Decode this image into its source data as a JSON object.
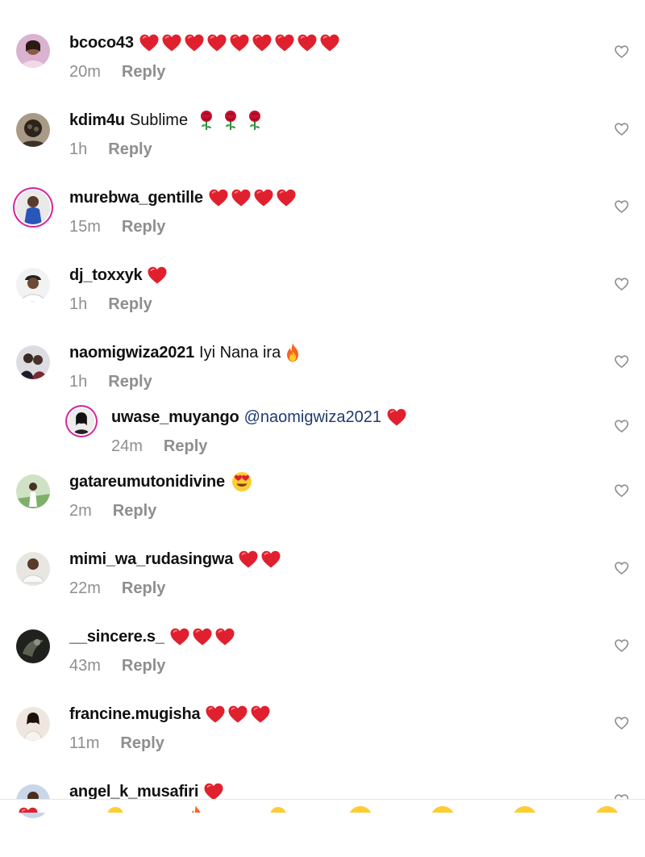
{
  "reply_label": "Reply",
  "colors": {
    "username": "#111111",
    "meta": "#8e8e8e",
    "mention": "#1f3a6e",
    "heart": "#e0202e",
    "story_ring": "#d6249f"
  },
  "icons": {
    "like": "heart-outline-icon",
    "heart_emoji": "red-heart-icon",
    "rose_emoji": "rose-icon",
    "fire_emoji": "fire-icon",
    "heart_eyes_emoji": "heart-eyes-icon"
  },
  "comments": [
    {
      "username": "bcoco43",
      "text": "",
      "hearts": 9,
      "time": "20m"
    },
    {
      "username": "kdim4u",
      "text": "Sublime",
      "roses": 3,
      "time": "1h"
    },
    {
      "username": "murebwa_gentille",
      "text": "",
      "hearts": 4,
      "time": "15m"
    },
    {
      "username": "dj_toxxyk",
      "text": "",
      "hearts": 1,
      "time": "1h"
    },
    {
      "username": "naomigwiza2021",
      "text": "Iyi Nana ira",
      "emoji": "fire",
      "time": "1h"
    },
    {
      "username": "uwase_muyango",
      "mention": "@naomigwiza2021",
      "hearts": 1,
      "time": "24m"
    },
    {
      "username": "gatareumutonidivine",
      "text": "",
      "emoji": "heart-eyes",
      "time": "2m"
    },
    {
      "username": "mimi_wa_rudasingwa",
      "text": "",
      "hearts": 2,
      "time": "22m"
    },
    {
      "username": "__sincere.s_",
      "text": "",
      "hearts": 3,
      "time": "43m"
    },
    {
      "username": "francine.mugisha",
      "text": "",
      "hearts": 3,
      "time": "11m"
    },
    {
      "username": "angel_k_musafiri",
      "text": "",
      "hearts": 1,
      "time": ""
    }
  ]
}
